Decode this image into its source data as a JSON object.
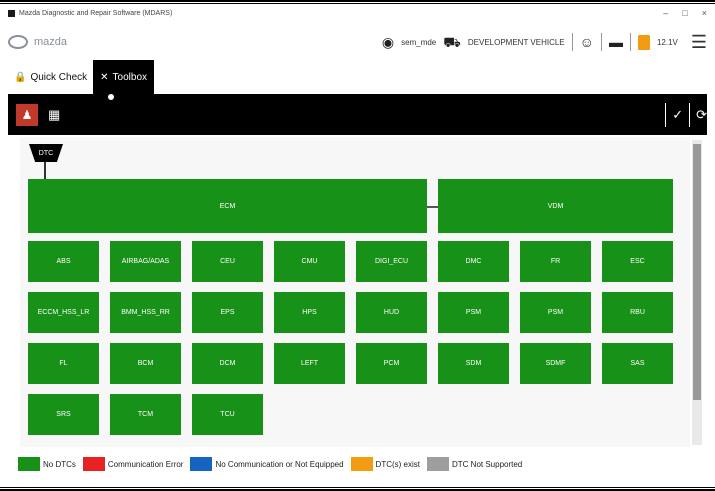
{
  "window": {
    "title": "Mazda Diagnostic and Repair Software (MDARS)",
    "controls": [
      "–",
      "□",
      "×"
    ]
  },
  "header": {
    "brand": "mazda",
    "battery_level": "12.1V",
    "user_label": "sem_mde",
    "vehicle_label": "DEVELOPMENT VEHICLE",
    "icons": {
      "user": "user-circle-icon",
      "vehicle": "car-icon",
      "technician": "person-icon",
      "vci": "vci-device-icon",
      "battery": "battery-icon",
      "menu": "hamburger-menu-icon"
    }
  },
  "tabs": [
    {
      "label": "Quick Check",
      "icon": "lock-icon"
    },
    {
      "label": "Toolbox",
      "icon": "tools-icon"
    }
  ],
  "toolbar": {
    "left": [
      "network-topology-icon",
      "table-view-icon"
    ],
    "right": [
      "checkmark-icon",
      "refresh-icon"
    ]
  },
  "network": {
    "dtc_tag": "DTC",
    "top_modules": [
      "ECM",
      "VDM"
    ],
    "modules": [
      [
        "ABS",
        "AIRBAG/ADAS",
        "CEU",
        "CMU",
        "DIGI_ECU",
        "DMC",
        "FR",
        "ESC"
      ],
      [
        "ECCM_HSS_LR",
        "BMM_HSS_RR",
        "EPS",
        "HPS",
        "HUD",
        "PSM",
        "PSM",
        "RBU"
      ],
      [
        "FL",
        "BCM",
        "DCM",
        "LEFT",
        "PCM",
        "SDM",
        "SDMF",
        "SAS"
      ],
      [
        "SRS",
        "TCM",
        "TCU"
      ]
    ]
  },
  "legend": [
    {
      "label": "No DTCs",
      "color": "#189118"
    },
    {
      "label": "Communication Error",
      "color": "#e82222"
    },
    {
      "label": "No Communication or Not Equipped",
      "color": "#1565c0"
    },
    {
      "label": "DTC(s) exist",
      "color": "#f39c12"
    },
    {
      "label": "DTC Not Supported",
      "color": "#9e9e9e"
    }
  ],
  "colors": {
    "module_ok": "#189118",
    "toolbar_bg": "#000000",
    "active_button": "#c0392b"
  }
}
